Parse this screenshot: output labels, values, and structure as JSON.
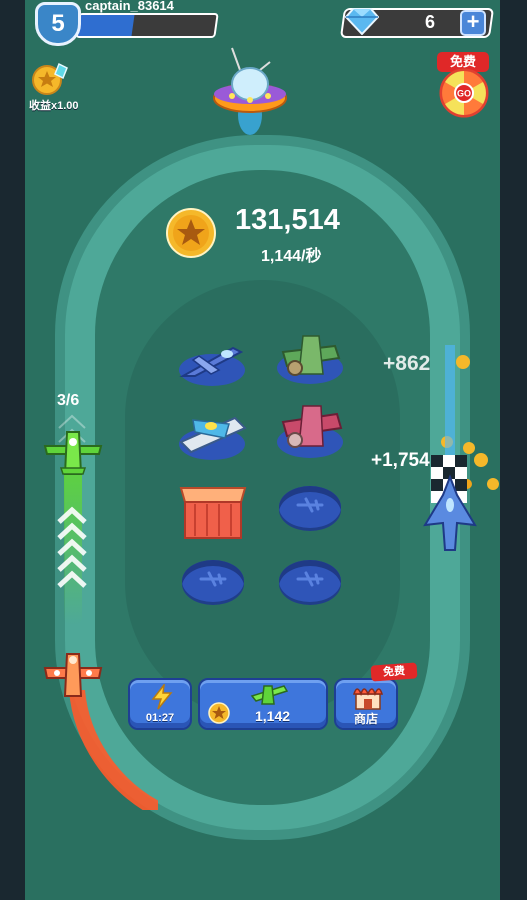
{
  "player": {
    "level": "5",
    "username": "captain_83614",
    "xp_progress": 0.4
  },
  "currency": {
    "gems": "6",
    "add_gems_label": "+"
  },
  "income": {
    "multiplier_label": "收益x1.00"
  },
  "free_spin": {
    "tag": "免费",
    "wheel_label": "GO"
  },
  "coins": {
    "total": "131,514",
    "rate": "1,144/秒"
  },
  "race": {
    "lap_count": "3/6",
    "floating_income_1": "+862",
    "floating_income_2": "+1,754"
  },
  "bottom_bar": {
    "boost_timer": "01:27",
    "buy_cost": "1,142",
    "shop_label": "商店",
    "shop_free_tag": "免费"
  },
  "colors": {
    "background": "#2a7060",
    "track": "#4ea898",
    "button_blue": "#3e76dc",
    "badge_red": "#e02828",
    "coin_gold": "#f5b82a"
  }
}
